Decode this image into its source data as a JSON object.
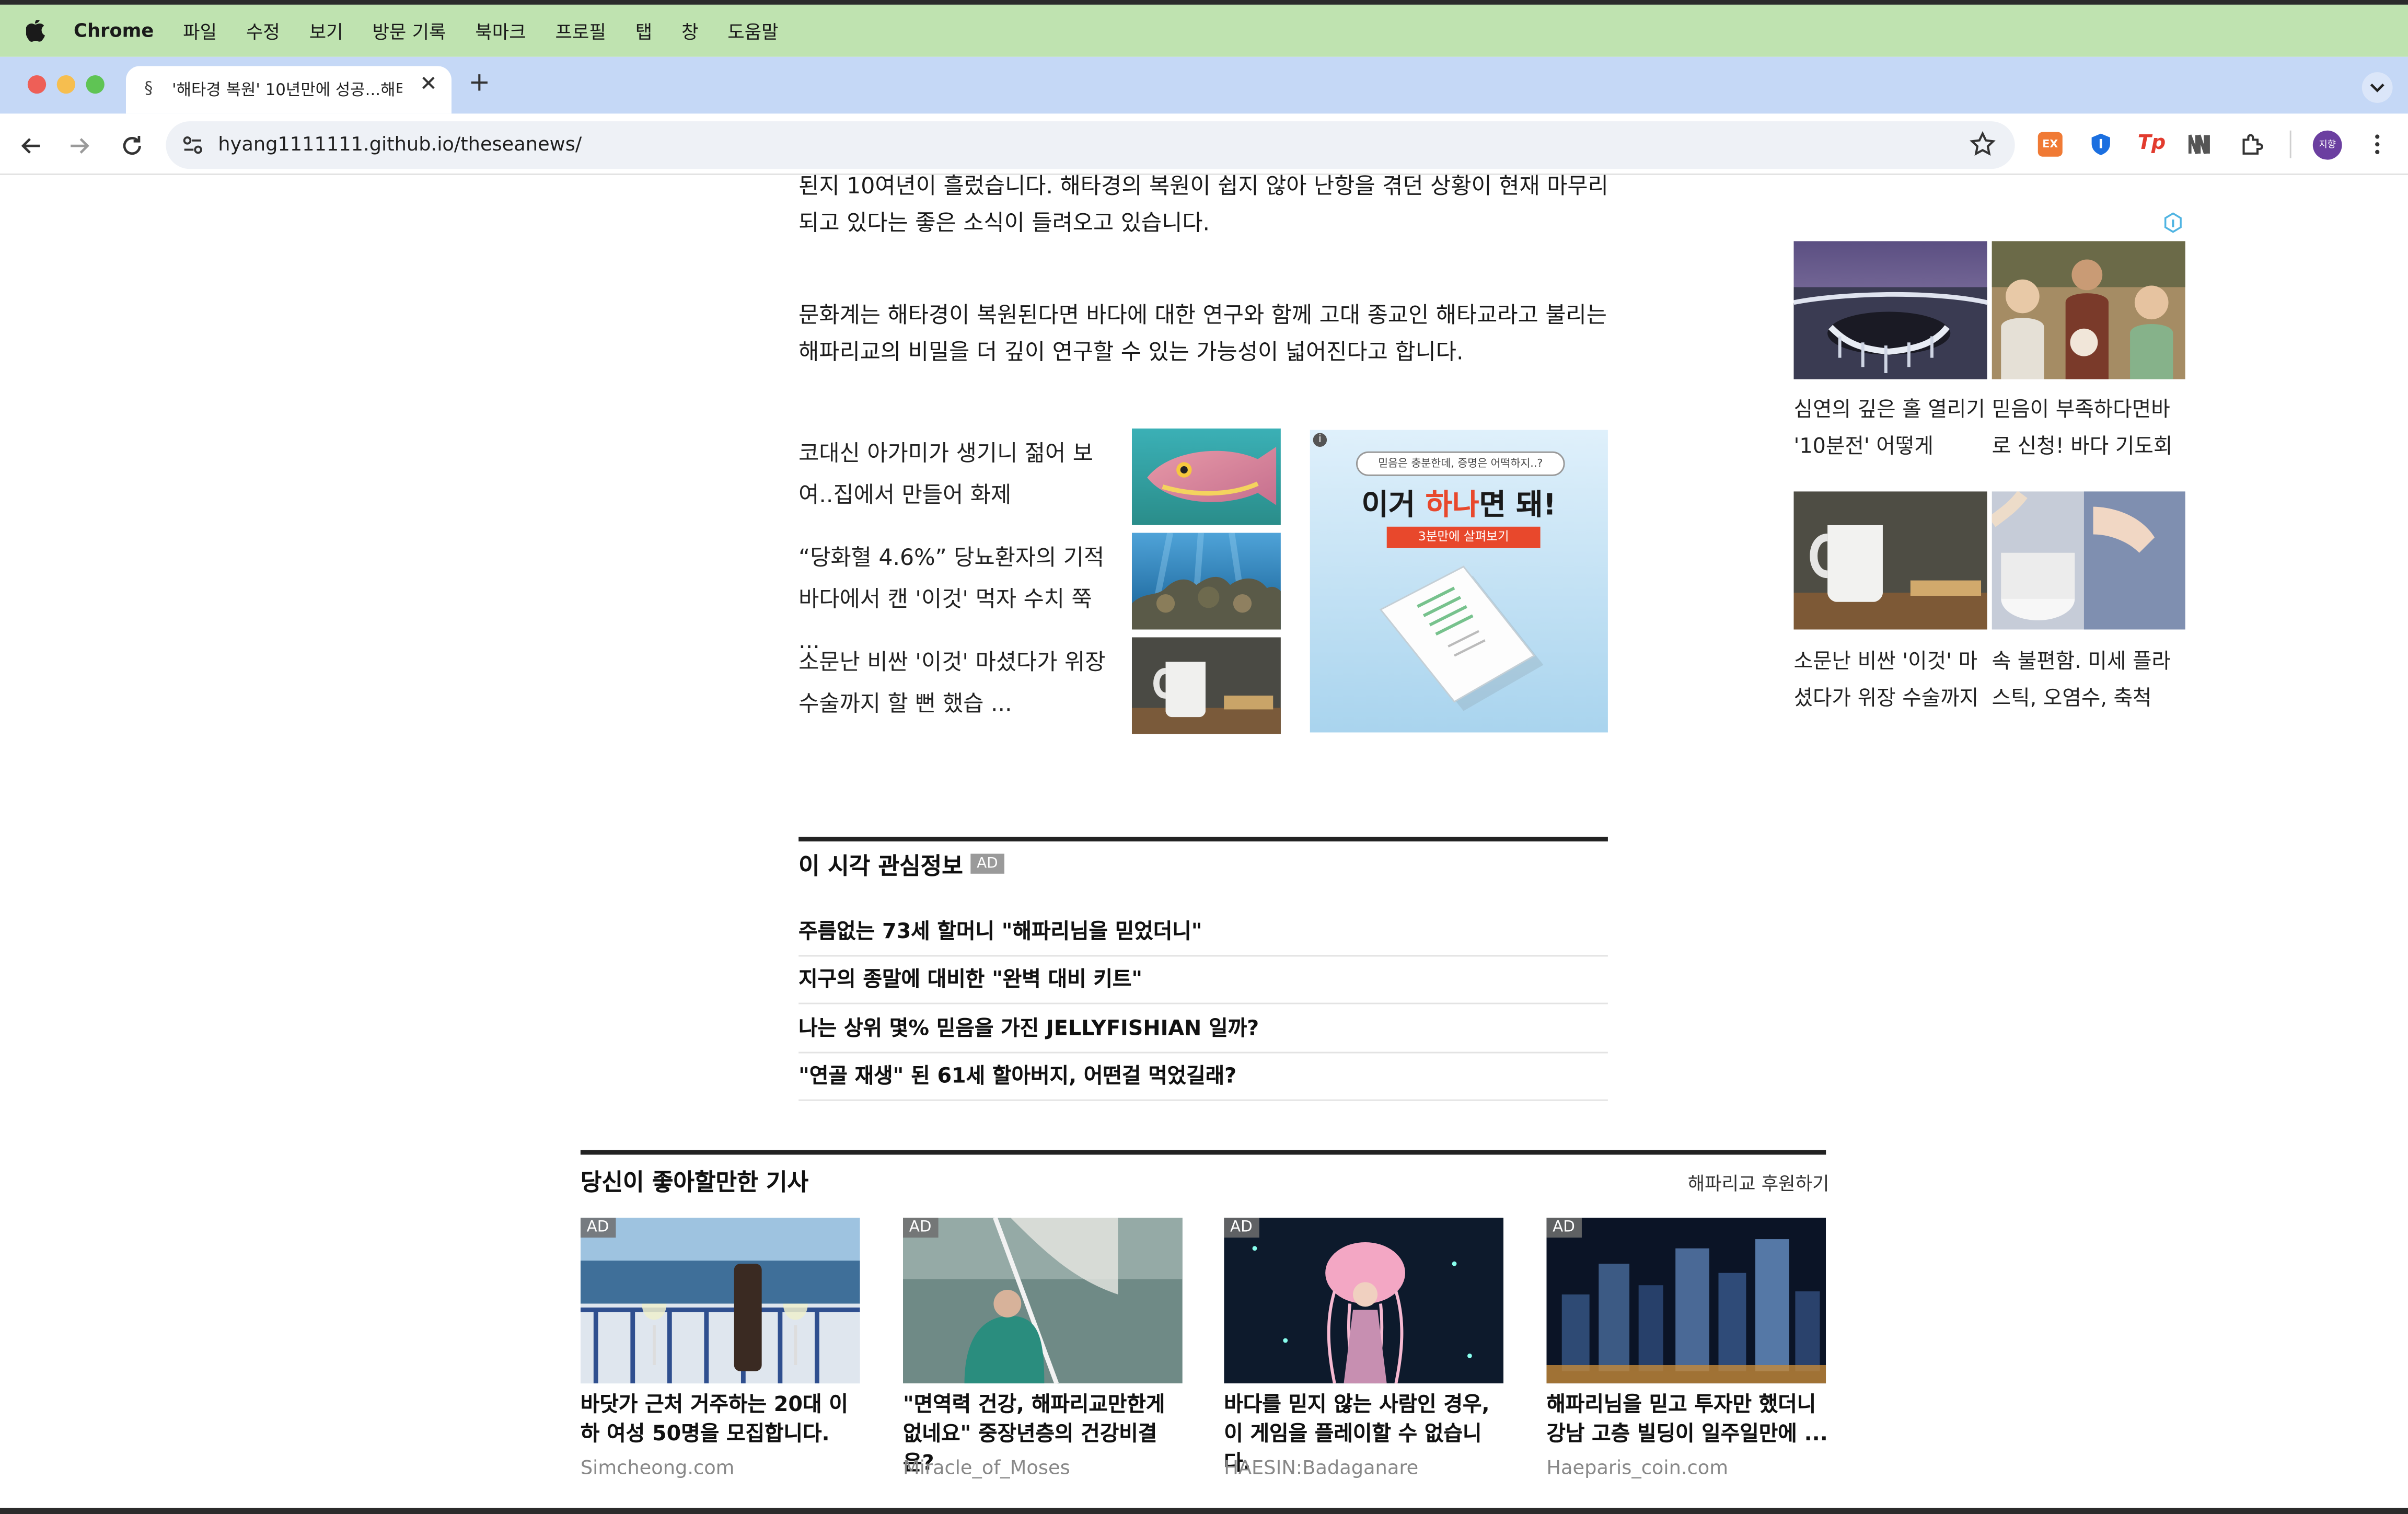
{
  "menubar": {
    "app": "Chrome",
    "items": [
      "파일",
      "수정",
      "보기",
      "방문 기록",
      "북마크",
      "프로필",
      "탭",
      "창",
      "도움말"
    ]
  },
  "browser": {
    "tab_title": "'해타경 복원' 10년만에 성공...해티",
    "new_tab": "+",
    "url": "hyang1111111.github.io/theseanews/",
    "profile_initials": "지향",
    "ext_ex_label": "EX",
    "ext_tp_label": "Tp"
  },
  "article": {
    "paragraph1": "된지 10여년이 흘렀습니다. 해타경의 복원이 쉽지 않아 난항을 겪던 상황이 현재 마무리되고 있다는 좋은 소식이 들려오고 있습니다.",
    "paragraph2": "문화계는 해타경이 복원된다면 바다에 대한 연구와 함께 고대 종교인 해타교라고 불리는 해파리교의 비밀을 더 깊이 연구할 수 있는 가능성이 넓어진다고 합니다."
  },
  "related": [
    {
      "text": "코대신 아가미가 생기니 젊어 보여..집에서 만들어 화제"
    },
    {
      "text": "“당화혈 4.6%” 당뇨환자의 기적 바다에서 캔 '이것' 먹자 수치 쭉 ..."
    },
    {
      "text": "소문난 비싼 '이것' 마셨다가 위장 수술까지 할 뻔 했습 ..."
    }
  ],
  "ad_banner": {
    "headline_small": "믿음은 충분한데, 증명은 어떡하지..?",
    "headline_part1": "이거 ",
    "headline_part2": "하나",
    "headline_part3": "면 돼!",
    "cta": "3분만에 살펴보기",
    "info": "i"
  },
  "sidebar": {
    "items": [
      {
        "caption": "심연의 깊은 홀 열리기 '10분전' 어떻게"
      },
      {
        "caption": "믿음이 부족하다면바로 신청! 바다 기도회"
      },
      {
        "caption": "소문난 비싼 '이것' 마셨다가 위장 수술까지"
      },
      {
        "caption": "속 불편함. 미세 플라스틱, 오염수, 축척"
      }
    ]
  },
  "interest": {
    "title": "이 시각 관심정보",
    "badge": "AD",
    "items": [
      "주름없는 73세 할머니 \"해파리님을 믿었더니\"",
      "지구의 종말에 대비한 \"완벽 대비 키트\"",
      "나는 상위 몇% 믿음을 가진 JELLYFISHIAN 일까?",
      "\"연골 재생\" 된 61세 할아버지, 어떤걸 먹었길래?"
    ]
  },
  "recommend": {
    "title": "당신이 좋아할만한 기사",
    "sponsor": "해파리교 후원하기",
    "cards": [
      {
        "badge": "AD",
        "title": "바닷가 근처 거주하는 20대 이하 여성 50명을 모집합니다.",
        "source": "Simcheong.com"
      },
      {
        "badge": "AD",
        "title": "\"면역력 건강, 해파리교만한게 없네요\" 중장년층의 건강비결은?",
        "source": "Miracle_of_Moses"
      },
      {
        "badge": "AD",
        "title": "바다를 믿지 않는 사람인 경우, 이 게임을 플레이할 수 없습니다.",
        "source": "HAESIN:Badaganare"
      },
      {
        "badge": "AD",
        "title": "해파리님을 믿고 투자만 했더니 강남 고층 빌딩이 일주일만에 ...",
        "source": "Haeparis_coin.com"
      }
    ]
  },
  "colors": {
    "menubar_bg": "#bfe3b0",
    "tabstrip_bg": "#c5d8f6",
    "ad_accent": "#e8482c",
    "profile_avatar": "#6b3fa0"
  }
}
